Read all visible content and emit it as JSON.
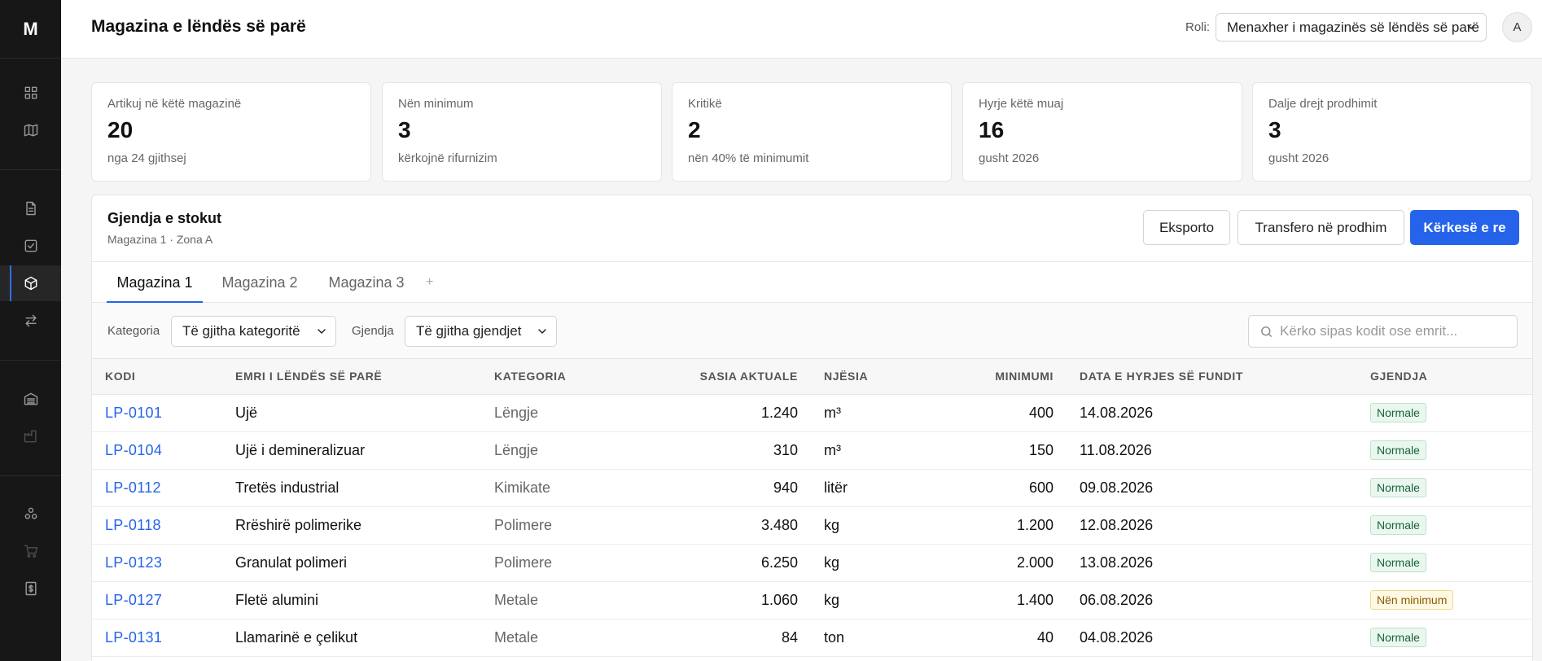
{
  "app": {
    "logo": "M",
    "page_title": "Magazina e lëndës së parë"
  },
  "topbar": {
    "role_label": "Roli:",
    "role_value": "Menaxher i magazinës së lëndës së parë",
    "avatar": "A"
  },
  "sidebar": {
    "icons": [
      "dashboard-icon",
      "map-icon",
      "document-icon",
      "checklist-icon",
      "box-icon",
      "transfer-icon",
      "warehouse-icon",
      "factory-icon",
      "network-icon",
      "cart-icon",
      "invoice-icon"
    ],
    "active": "box-icon"
  },
  "stats": [
    {
      "label": "Artikuj në këtë magazinë",
      "value": "20",
      "sub": "nga 24 gjithsej"
    },
    {
      "label": "Nën minimum",
      "value": "3",
      "sub": "kërkojnë rifurnizim"
    },
    {
      "label": "Kritikë",
      "value": "2",
      "sub": "nën 40% të minimumit"
    },
    {
      "label": "Hyrje këtë muaj",
      "value": "16",
      "sub": "gusht 2026"
    },
    {
      "label": "Dalje drejt prodhimit",
      "value": "3",
      "sub": "gusht 2026"
    }
  ],
  "panel": {
    "title": "Gjendja e stokut",
    "subtitle": "Magazina 1 · Zona A",
    "buttons": {
      "export": "Eksporto",
      "transfer": "Transfero në prodhim",
      "new_request": "Kërkesë e re"
    }
  },
  "tabs": {
    "items": [
      "Magazina 1",
      "Magazina 2",
      "Magazina 3"
    ],
    "add": "+",
    "active_index": 0
  },
  "filters": {
    "category_label": "Kategoria",
    "category_value": "Të gjitha kategoritë",
    "status_label": "Gjendja",
    "status_value": "Të gjitha gjendjet",
    "search_placeholder": "Kërko sipas kodit ose emrit..."
  },
  "table": {
    "headers": [
      "KODI",
      "EMRI I LËNDËS SË PARË",
      "KATEGORIA",
      "SASIA AKTUALE",
      "NJËSIA",
      "MINIMUMI",
      "DATA E HYRJES SË FUNDIT",
      "GJENDJA"
    ],
    "rows": [
      {
        "code": "LP-0101",
        "name": "Ujë",
        "category": "Lëngje",
        "qty": "1.240",
        "unit": "m³",
        "min": "400",
        "date": "14.08.2026",
        "status": "Normale",
        "status_type": "ok"
      },
      {
        "code": "LP-0104",
        "name": "Ujë i demineralizuar",
        "category": "Lëngje",
        "qty": "310",
        "unit": "m³",
        "min": "150",
        "date": "11.08.2026",
        "status": "Normale",
        "status_type": "ok"
      },
      {
        "code": "LP-0112",
        "name": "Tretës industrial",
        "category": "Kimikate",
        "qty": "940",
        "unit": "litër",
        "min": "600",
        "date": "09.08.2026",
        "status": "Normale",
        "status_type": "ok"
      },
      {
        "code": "LP-0118",
        "name": "Rrëshirë polimerike",
        "category": "Polimere",
        "qty": "3.480",
        "unit": "kg",
        "min": "1.200",
        "date": "12.08.2026",
        "status": "Normale",
        "status_type": "ok"
      },
      {
        "code": "LP-0123",
        "name": "Granulat polimeri",
        "category": "Polimere",
        "qty": "6.250",
        "unit": "kg",
        "min": "2.000",
        "date": "13.08.2026",
        "status": "Normale",
        "status_type": "ok"
      },
      {
        "code": "LP-0127",
        "name": "Fletë alumini",
        "category": "Metale",
        "qty": "1.060",
        "unit": "kg",
        "min": "1.400",
        "date": "06.08.2026",
        "status": "Nën minimum",
        "status_type": "warn"
      },
      {
        "code": "LP-0131",
        "name": "Llamarinë e çelikut",
        "category": "Metale",
        "qty": "84",
        "unit": "ton",
        "min": "40",
        "date": "04.08.2026",
        "status": "Normale",
        "status_type": "ok"
      }
    ]
  },
  "colors": {
    "accent": "#2563eb",
    "sidebar_bg": "#171717",
    "ok": "#17623a",
    "warn": "#8a5a00"
  }
}
